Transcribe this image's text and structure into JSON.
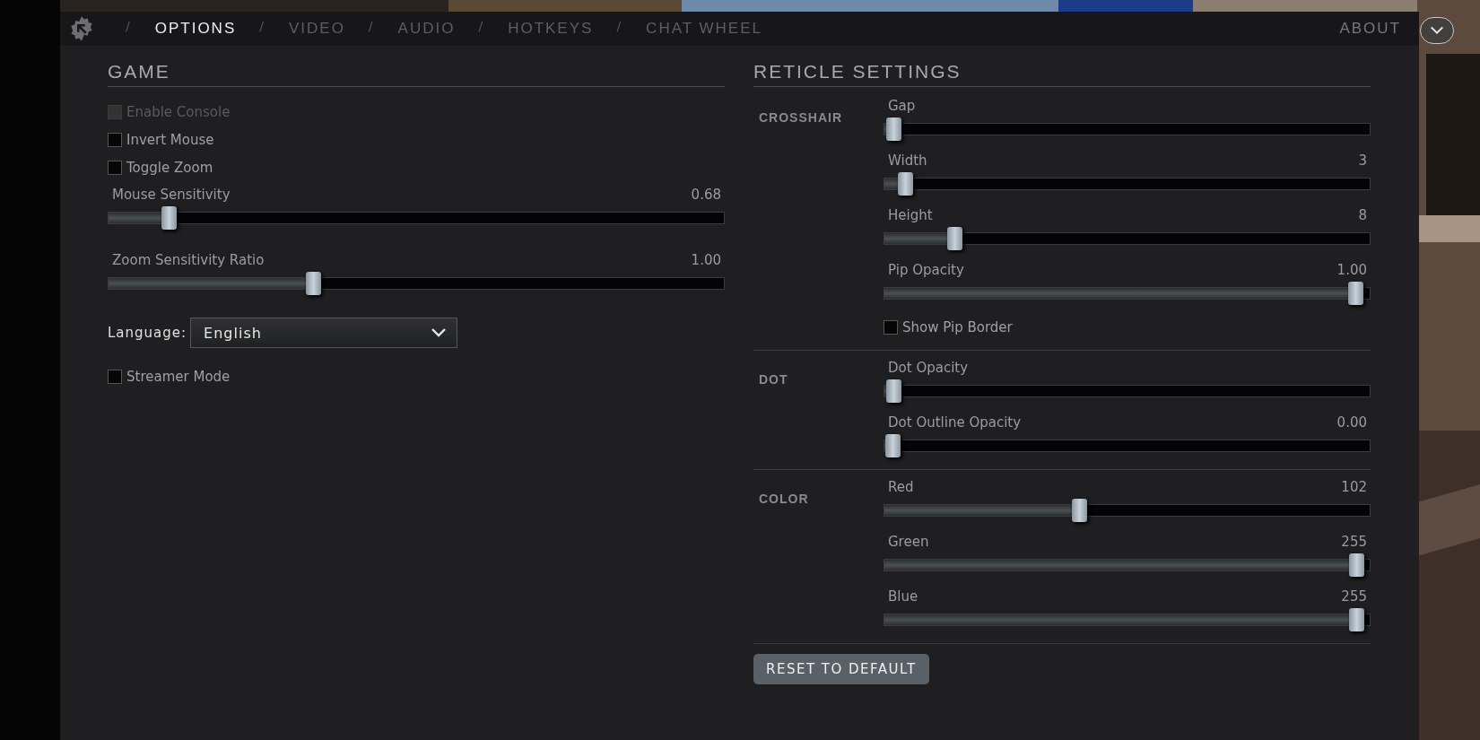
{
  "window": {
    "tabs": [
      {
        "separator": "/",
        "label": "OPTIONS",
        "selected": true
      },
      {
        "separator": "/",
        "label": "VIDEO",
        "selected": false
      },
      {
        "separator": "/",
        "label": "AUDIO",
        "selected": false
      },
      {
        "separator": "/",
        "label": "HOTKEYS",
        "selected": false
      },
      {
        "separator": "/",
        "label": "CHAT WHEEL",
        "selected": false
      }
    ],
    "about": "ABOUT"
  },
  "game": {
    "title": "GAME",
    "items": [
      {
        "kind": "checkbox",
        "label": "Enable Console",
        "checked": false,
        "disabled": true
      },
      {
        "kind": "checkbox",
        "label": "Invert Mouse",
        "checked": false,
        "disabled": false
      },
      {
        "kind": "checkbox",
        "label": "Toggle Zoom",
        "checked": false,
        "disabled": false
      },
      {
        "kind": "slider",
        "label": "Mouse Sensitivity",
        "reading": "0.68",
        "level": 0.09
      },
      {
        "kind": "slider",
        "label": "Zoom Sensitivity Ratio",
        "reading": "1.00",
        "level": 0.33
      },
      {
        "kind": "dropdown",
        "label": "Language:",
        "value": "English"
      },
      {
        "kind": "checkbox",
        "label": "Streamer Mode",
        "checked": false,
        "disabled": false
      }
    ]
  },
  "reticle": {
    "title": "RETICLE SETTINGS",
    "sections": [
      {
        "title": "CROSSHAIR",
        "items": [
          {
            "kind": "slider",
            "label": "Gap",
            "level": 0.005
          },
          {
            "kind": "slider",
            "label": "Width",
            "reading": "3",
            "level": 0.03
          },
          {
            "kind": "slider",
            "label": "Height",
            "reading": "8",
            "level": 0.135
          },
          {
            "kind": "slider",
            "label": "Pip Opacity",
            "reading": "1.00",
            "level": 0.985
          },
          {
            "kind": "checkbox",
            "label": "Show Pip Border",
            "checked": false,
            "disabled": false
          }
        ]
      },
      {
        "title": "DOT",
        "items": [
          {
            "kind": "slider",
            "label": "Dot Opacity",
            "level": 0.005
          },
          {
            "kind": "slider",
            "label": "Dot Outline Opacity",
            "reading": "0.00",
            "level": 0.003
          }
        ]
      },
      {
        "title": "COLOR",
        "items": [
          {
            "kind": "slider",
            "label": "Red",
            "reading": "102",
            "level": 0.4
          },
          {
            "kind": "slider",
            "label": "Green",
            "reading": "255",
            "level": 0.987
          },
          {
            "kind": "slider",
            "label": "Blue",
            "reading": "255",
            "level": 0.987
          }
        ]
      }
    ],
    "reset_button": "RESET TO DEFAULT"
  }
}
